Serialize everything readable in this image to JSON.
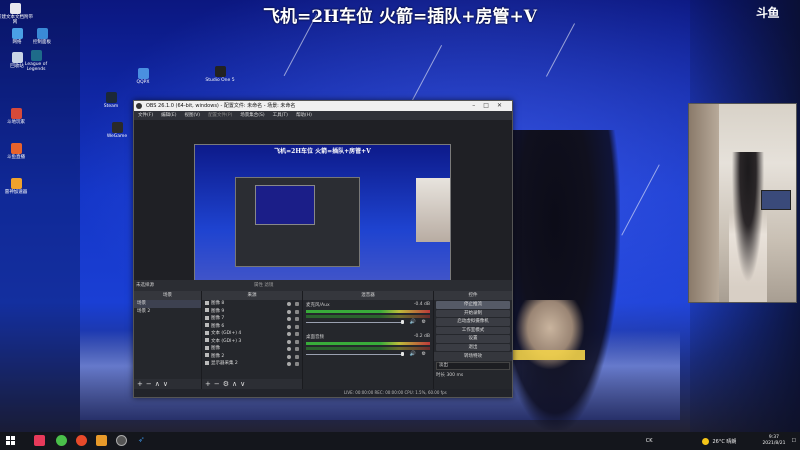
{
  "stream": {
    "banner": "飞机=2H车位 火箭=插队+房管+V",
    "logo": "斗鱼"
  },
  "desktop_icons": [
    {
      "label": "新建文本文档附带网",
      "color": "#e8e8ef"
    },
    {
      "label": "网络",
      "color": "#4aa0e6"
    },
    {
      "label": "控制面板",
      "color": "#3a8ad6"
    },
    {
      "label": "回收站",
      "color": "#c9d4e6"
    },
    {
      "label": "League of Legends",
      "color": "#1e6b8a"
    },
    {
      "label": "QQPX",
      "color": "#4a8fe0"
    },
    {
      "label": "Studio One 5",
      "color": "#222"
    },
    {
      "label": "Steam",
      "color": "#1b2838"
    },
    {
      "label": "WeGame",
      "color": "#2a2a2a"
    },
    {
      "label": "斗地玩家",
      "color": "#d64a3a"
    },
    {
      "label": "斗鱼直播",
      "color": "#e8622c"
    },
    {
      "label": "雷神加速器",
      "color": "#f0a22c"
    }
  ],
  "obs": {
    "title": "OBS 26.1.0 (64-bit, windows) - 配置文件: 未命名 - 场景: 未命名",
    "menu": [
      "文件(F)",
      "编辑(E)",
      "视图(V)",
      "配置文件(P)",
      "场景集合(S)",
      "工具(T)",
      "帮助(H)"
    ],
    "preview_title": "飞机=2H车位 火箭=插队+房管+V",
    "source_bar_label": "未选择源",
    "source_bar_controls": "属性  滤镜",
    "docks": {
      "scenes": {
        "header": "场景",
        "items": [
          "场景",
          "场景 2"
        ]
      },
      "sources": {
        "header": "来源",
        "items": [
          "图像 8",
          "图像 9",
          "图像 7",
          "图像 6",
          "文本 (GDI+) 4",
          "文本 (GDI+) 3",
          "图像",
          "图像 2",
          "显示器采集 2"
        ]
      },
      "mixer": {
        "header": "混音器",
        "channels": [
          {
            "name": "麦克风/Aux",
            "db": "-0.4 dB"
          },
          {
            "name": "桌面音频",
            "db": "-0.2 dB"
          }
        ]
      },
      "controls": {
        "header": "控件",
        "buttons": [
          "停止推流",
          "开始录制",
          "启动虚拟摄像机",
          "工作室模式",
          "设置",
          "退出"
        ]
      },
      "transitions": {
        "header": "转场特效",
        "transition": "淡出",
        "duration_label": "时长",
        "duration_value": "300 ms"
      }
    },
    "status": "LIVE: 00:00:00   REC: 00:00:00   CPU: 1.5%, 60.00 fps"
  },
  "taskbar": {
    "weather": "26°C 晴朗",
    "time": "9:37",
    "date": "2021/8/21",
    "tray_text": "CK",
    "apps_colors": [
      "#e83a5a",
      "#4ac04a",
      "#e84a2a",
      "#e89a2a",
      "#666",
      "#3a8ad6"
    ]
  }
}
